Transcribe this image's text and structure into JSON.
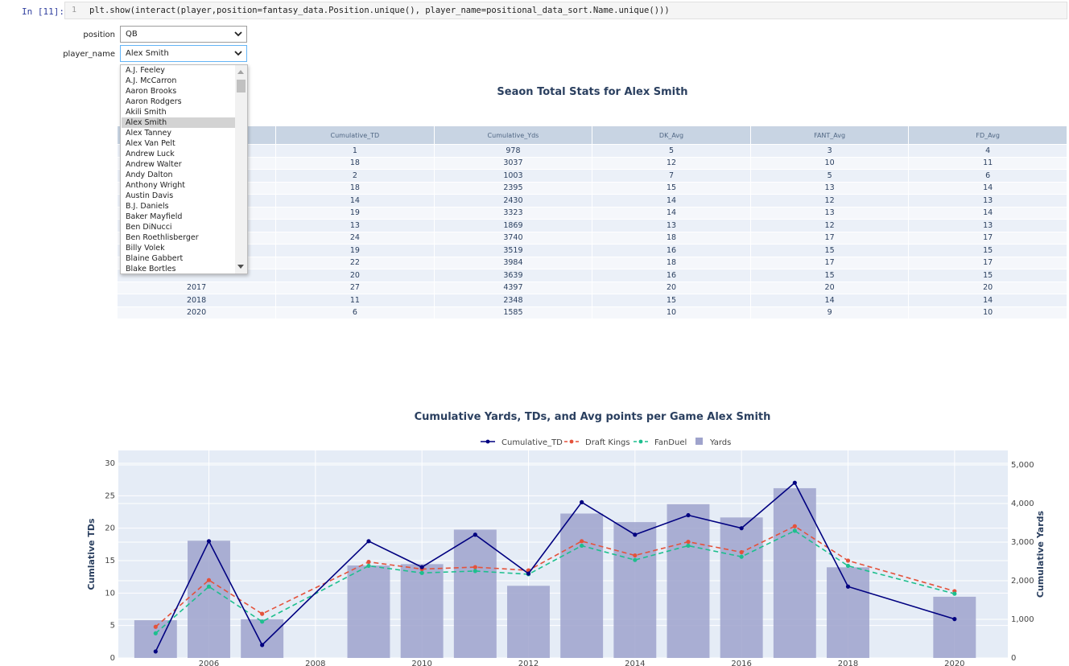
{
  "cell": {
    "prompt": "In [11]:",
    "line_no": "1",
    "code": "plt.show(interact(player,position=fantasy_data.Position.unique(), player_name=positional_data_sort.Name.unique()))"
  },
  "widgets": {
    "position_label": "position",
    "position_value": "QB",
    "player_label": "player_name",
    "player_value": "Alex Smith"
  },
  "dropdown_options": [
    "A.J. Feeley",
    "A.J. McCarron",
    "Aaron Brooks",
    "Aaron Rodgers",
    "Akili Smith",
    "Alex Smith",
    "Alex Tanney",
    "Alex Van Pelt",
    "Andrew Luck",
    "Andrew Walter",
    "Andy Dalton",
    "Anthony Wright",
    "Austin Davis",
    "B.J. Daniels",
    "Baker Mayfield",
    "Ben DiNucci",
    "Ben Roethlisberger",
    "Billy Volek",
    "Blaine Gabbert",
    "Blake Bortles"
  ],
  "selected_option": "Alex Smith",
  "table": {
    "title": "Seaon Total Stats for Alex Smith",
    "headers": [
      "",
      "Cumulative_TD",
      "Cumulative_Yds",
      "DK_Avg",
      "FANT_Avg",
      "FD_Avg"
    ],
    "rows": [
      [
        "",
        "1",
        "978",
        "5",
        "3",
        "4"
      ],
      [
        "",
        "18",
        "3037",
        "12",
        "10",
        "11"
      ],
      [
        "",
        "2",
        "1003",
        "7",
        "5",
        "6"
      ],
      [
        "",
        "18",
        "2395",
        "15",
        "13",
        "14"
      ],
      [
        "",
        "14",
        "2430",
        "14",
        "12",
        "13"
      ],
      [
        "",
        "19",
        "3323",
        "14",
        "13",
        "14"
      ],
      [
        "",
        "13",
        "1869",
        "13",
        "12",
        "13"
      ],
      [
        "",
        "24",
        "3740",
        "18",
        "17",
        "17"
      ],
      [
        "",
        "19",
        "3519",
        "16",
        "15",
        "15"
      ],
      [
        "",
        "22",
        "3984",
        "18",
        "17",
        "17"
      ],
      [
        "",
        "20",
        "3639",
        "16",
        "15",
        "15"
      ],
      [
        "2017",
        "27",
        "4397",
        "20",
        "20",
        "20"
      ],
      [
        "2018",
        "11",
        "2348",
        "15",
        "14",
        "14"
      ],
      [
        "2020",
        "6",
        "1585",
        "10",
        "9",
        "10"
      ]
    ]
  },
  "colors": {
    "td": "#000080",
    "dk": "#e4523b",
    "fd": "#1dbf8e",
    "bars": "#9fa3cc",
    "plot_bg": "#e5ecf6",
    "title": "#2a3f5f"
  },
  "chart_data": {
    "type": "bar",
    "title": "Cumulative Yards, TDs, and Avg points per Game Alex Smith",
    "x": [
      2005,
      2006,
      2007,
      2009,
      2010,
      2011,
      2012,
      2013,
      2014,
      2015,
      2016,
      2017,
      2018,
      2020
    ],
    "x_ticks": [
      2006,
      2008,
      2010,
      2012,
      2014,
      2016,
      2018,
      2020
    ],
    "ylabel_left": "Cumlative TDs",
    "ylabel_right": "Cumulative Yards",
    "ylim_left": [
      0,
      30
    ],
    "ylim_right": [
      0,
      5000
    ],
    "y_ticks_left": [
      "0",
      "5",
      "10",
      "15",
      "20",
      "25",
      "30"
    ],
    "y_ticks_right": [
      "0",
      "1,000",
      "2,000",
      "3,000",
      "4,000",
      "5,000"
    ],
    "legend_position": "top-center",
    "series": [
      {
        "name": "Cumulative_TD",
        "type": "line",
        "axis": "left",
        "values": [
          1,
          18,
          2,
          18,
          14,
          19,
          13,
          24,
          19,
          22,
          20,
          27,
          11,
          6
        ]
      },
      {
        "name": "Draft Kings",
        "type": "line-dashed",
        "axis": "left",
        "values": [
          4.8,
          12,
          6.8,
          14.8,
          13.7,
          14,
          13.5,
          18,
          15.8,
          17.9,
          16.3,
          20.3,
          15,
          10.3
        ]
      },
      {
        "name": "FanDuel",
        "type": "line-dashed",
        "axis": "left",
        "values": [
          3.8,
          11,
          5.6,
          14.2,
          13.1,
          13.4,
          12.9,
          17.3,
          15.1,
          17.3,
          15.6,
          19.6,
          14.2,
          9.9
        ]
      },
      {
        "name": "Yards",
        "type": "bar",
        "axis": "right",
        "values": [
          978,
          3037,
          1003,
          2395,
          2430,
          3323,
          1869,
          3740,
          3519,
          3984,
          3639,
          4397,
          2348,
          1585
        ]
      }
    ]
  }
}
